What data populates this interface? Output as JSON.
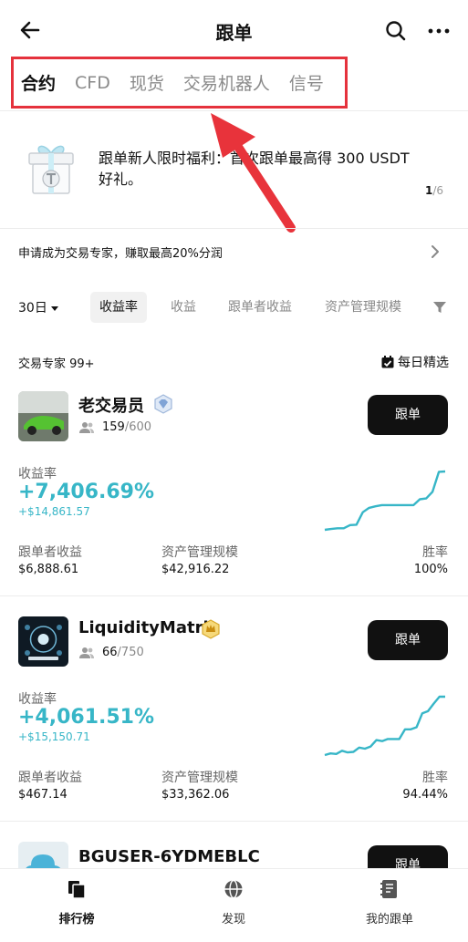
{
  "header": {
    "title": "跟单"
  },
  "tabs": [
    {
      "label": "合约",
      "active": true
    },
    {
      "label": "CFD",
      "active": false
    },
    {
      "label": "现货",
      "active": false
    },
    {
      "label": "交易机器人",
      "active": false
    },
    {
      "label": "信号",
      "active": false
    }
  ],
  "banner": {
    "text": "跟单新人限时福利：首次跟单最高得 300 USDT 好礼。",
    "page_current": "1",
    "page_total": "/6"
  },
  "expert_cta": {
    "text": "申请成为交易专家，赚取最高20%分润"
  },
  "filters": {
    "period": "30日",
    "chips": [
      "收益率",
      "收益",
      "跟单者收益",
      "资产管理规模"
    ],
    "active_chip": "收益率"
  },
  "list": {
    "count_label": "交易专家 99+",
    "daily_pick": "每日精选"
  },
  "traders": [
    {
      "name": "老交易员",
      "badge": "diamond",
      "followers": "159",
      "followers_max": "/600",
      "button": "跟单",
      "roi_label": "收益率",
      "roi": "+7,406.69%",
      "pnl": "+$14,861.57",
      "stats": [
        {
          "label": "跟单者收益",
          "value": "$6,888.61"
        },
        {
          "label": "资产管理规模",
          "value": "$42,916.22"
        },
        {
          "label": "胜率",
          "value": "100%"
        }
      ],
      "sparkline": [
        0,
        0.2,
        0.4,
        0.4,
        1.2,
        1.3,
        4.5,
        5.6,
        6.0,
        6.3,
        6.3,
        6.3,
        6.3,
        6.3,
        6.3,
        7.8,
        8.0,
        9.7,
        14.8,
        14.9
      ]
    },
    {
      "name": "LiquidityMatrix",
      "badge": "gold",
      "followers": "66",
      "followers_max": "/750",
      "button": "跟单",
      "roi_label": "收益率",
      "roi": "+4,061.51%",
      "pnl": "+$15,150.71",
      "stats": [
        {
          "label": "跟单者收益",
          "value": "$467.14"
        },
        {
          "label": "资产管理规模",
          "value": "$33,362.06"
        },
        {
          "label": "胜率",
          "value": "94.44%"
        }
      ],
      "sparkline": [
        0,
        0.3,
        0.2,
        0.8,
        0.5,
        0.6,
        1.4,
        1.2,
        1.6,
        2.8,
        2.6,
        3.0,
        3.0,
        3.0,
        4.8,
        4.8,
        5.2,
        7.8,
        8.2,
        9.6,
        10.9,
        10.9
      ]
    },
    {
      "name": "BGUSER-6YDMEBLC",
      "button": "跟单"
    }
  ],
  "bottom_nav": [
    {
      "label": "排行榜",
      "icon": "ranking-icon",
      "active": true
    },
    {
      "label": "发现",
      "icon": "globe-icon",
      "active": false
    },
    {
      "label": "我的跟单",
      "icon": "notebook-icon",
      "active": false
    }
  ],
  "colors": {
    "accent": "#37b6c7",
    "highlight_box": "#e5323c",
    "button": "#111111"
  }
}
